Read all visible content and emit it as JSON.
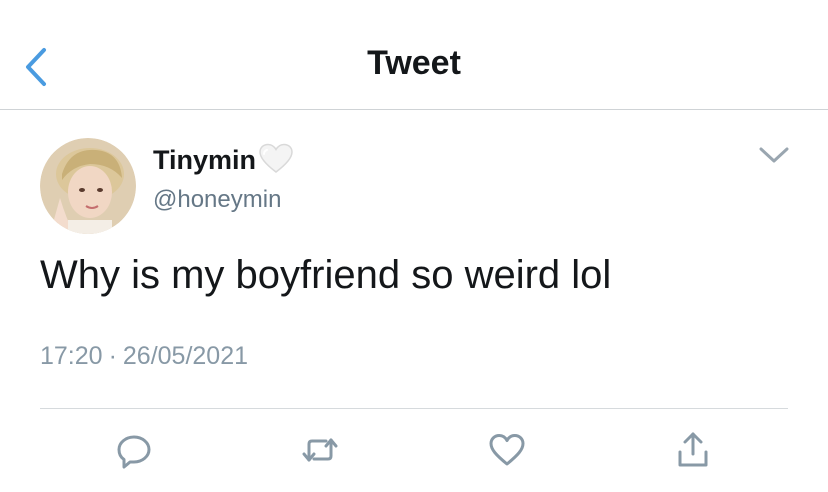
{
  "header": {
    "title": "Tweet",
    "back_icon": "chevron-left-icon"
  },
  "tweet": {
    "display_name": "Tinymin",
    "name_emoji": "white-heart-icon",
    "handle": "@honeymin",
    "text": "Why is my boyfriend so weird lol",
    "time": "17:20",
    "separator": "·",
    "date": "26/05/2021",
    "menu_icon": "chevron-down-icon"
  },
  "actions": [
    {
      "icon": "reply-icon"
    },
    {
      "icon": "retweet-icon"
    },
    {
      "icon": "like-icon"
    },
    {
      "icon": "share-icon"
    }
  ],
  "colors": {
    "accent": "#4a9be0",
    "text": "#14171a",
    "secondary": "#657786",
    "meta": "#8899a6",
    "icon": "#8899a6",
    "divider": "#d6dadd"
  }
}
